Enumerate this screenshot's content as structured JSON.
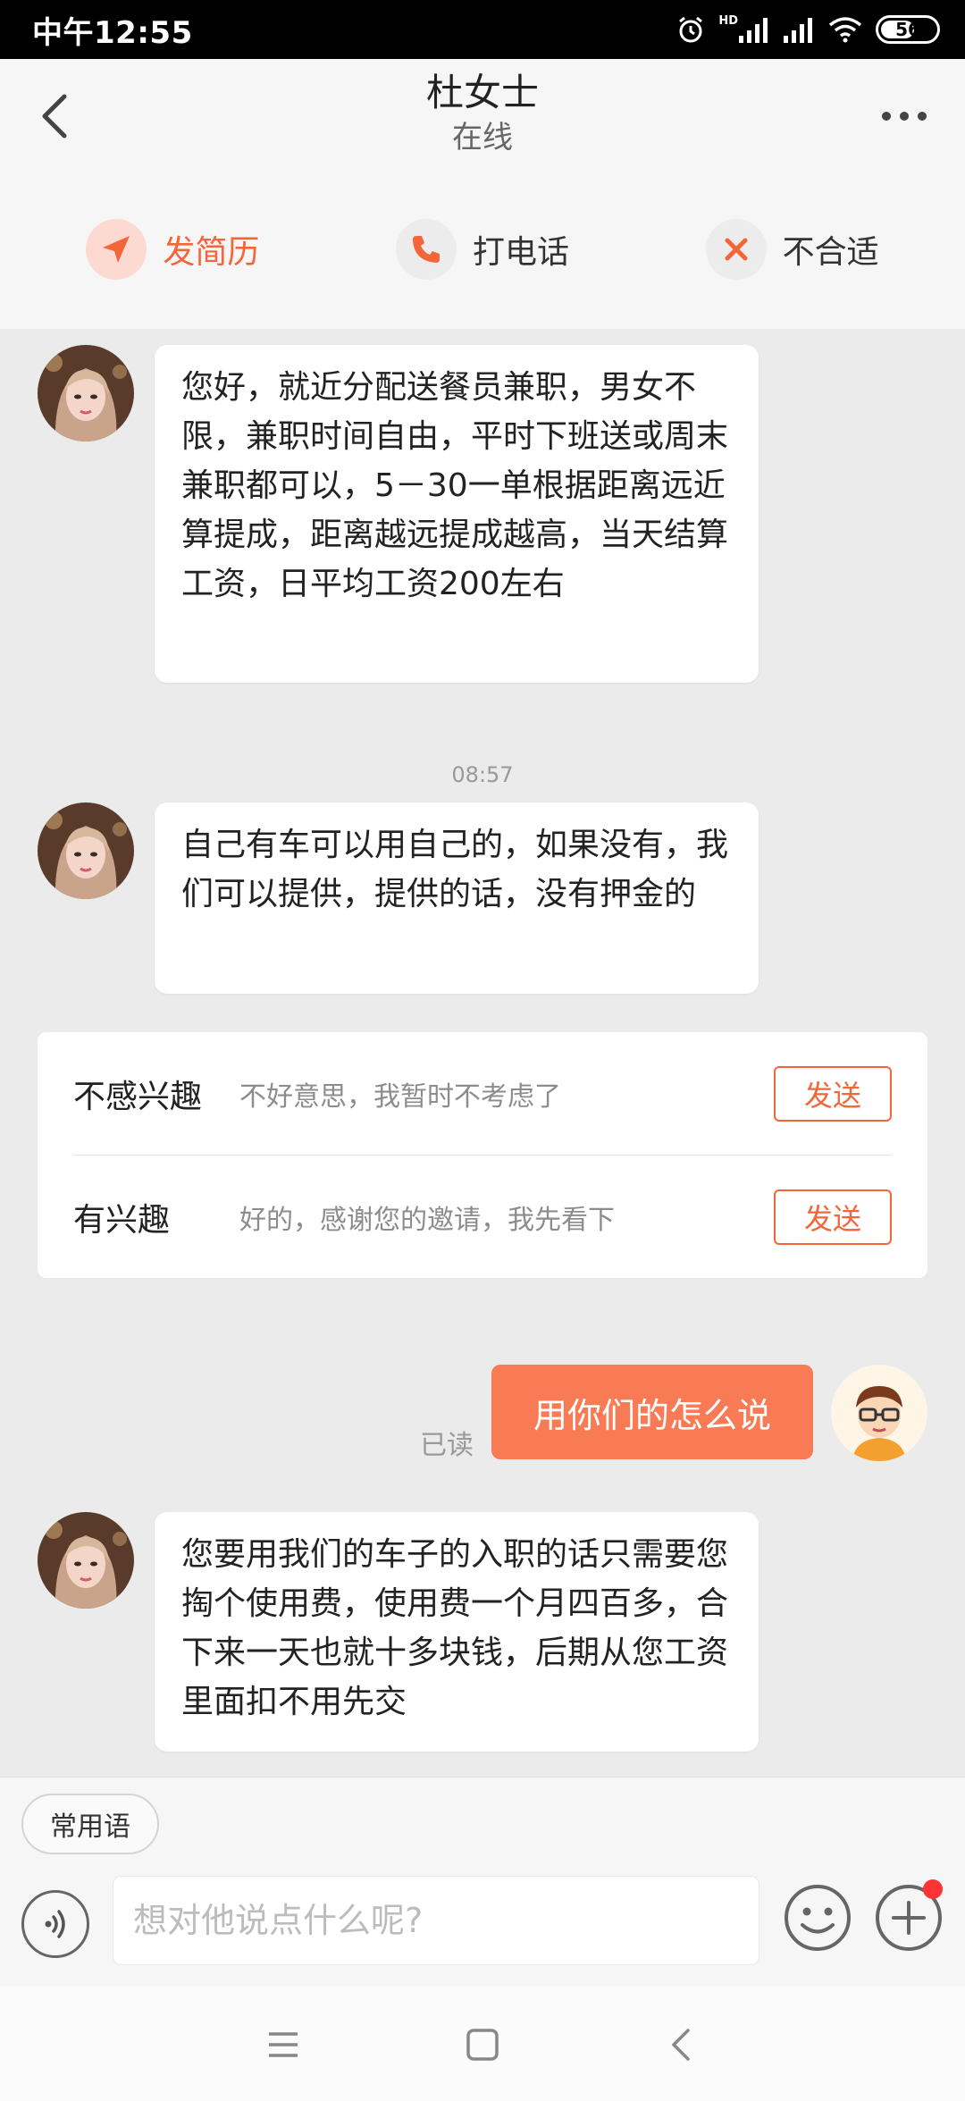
{
  "status_bar": {
    "time": "中午12:55",
    "battery": "56",
    "network": "HD"
  },
  "header": {
    "name": "杜女士",
    "status": "在线",
    "back_icon": "chevron-left-icon",
    "more_icon": "more-icon"
  },
  "actions": {
    "send_resume": "发简历",
    "call": "打电话",
    "not_suitable": "不合适",
    "colors": {
      "accent": "#f4663a",
      "accent_bg": "#fcdad2"
    }
  },
  "messages": [
    {
      "from": "杜女士",
      "text": "您好，就近分配送餐员兼职，男女不限，兼职时间自由，平时下班送或周末兼职都可以，5－30一单根据距离远近算提成，距离越远提成越高，当天结算工资，日平均工资200左右"
    },
    {
      "timestamp": "08:57"
    },
    {
      "from": "杜女士",
      "text": "自己有车可以用自己的，如果没有，我们可以提供，提供的话，没有押金的"
    },
    {
      "from": "me",
      "text": "用你们的怎么说",
      "read_label": "已读"
    },
    {
      "from": "杜女士",
      "text": "您要用我们的车子的入职的话只需要您掏个使用费，使用费一个月四百多，合下来一天也就十多块钱，后期从您工资里面扣不用先交"
    }
  ],
  "quick_replies": [
    {
      "title": "不感兴趣",
      "text": "不好意思，我暂时不考虑了",
      "button": "发送"
    },
    {
      "title": "有兴趣",
      "text": "好的，感谢您的邀请，我先看下",
      "button": "发送"
    }
  ],
  "input": {
    "common_phrases": "常用语",
    "placeholder": "想对他说点什么呢?",
    "voice_icon": "voice-icon",
    "emoji_icon": "emoji-icon",
    "plus_icon": "plus-icon"
  },
  "navbar": {
    "icons": [
      "menu-icon",
      "home-icon",
      "back-icon"
    ]
  },
  "colors": {
    "outgoing_bubble": "#f97b55",
    "background": "#ebebeb"
  }
}
